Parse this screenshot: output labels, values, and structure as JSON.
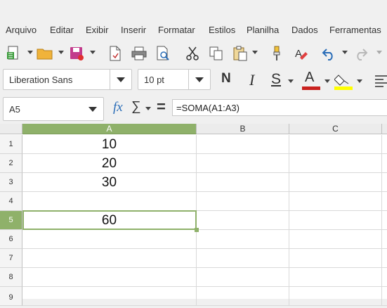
{
  "menu": [
    "Arquivo",
    "Editar",
    "Exibir",
    "Inserir",
    "Formatar",
    "Estilos",
    "Planilha",
    "Dados",
    "Ferramentas"
  ],
  "font": {
    "name": "Liberation Sans",
    "size": "10 pt"
  },
  "format_buttons": {
    "bold": "N",
    "italic": "I",
    "strike": "S",
    "font_color": "A"
  },
  "name_box": "A5",
  "formula": "=SOMA(A1:A3)",
  "functions": {
    "fx": "fx",
    "sum": "∑",
    "equals": "="
  },
  "columns": [
    "A",
    "B",
    "C"
  ],
  "rows": [
    {
      "num": "1",
      "a": "10"
    },
    {
      "num": "2",
      "a": "20"
    },
    {
      "num": "3",
      "a": "30"
    },
    {
      "num": "4",
      "a": ""
    },
    {
      "num": "5",
      "a": "60"
    },
    {
      "num": "6",
      "a": ""
    },
    {
      "num": "7",
      "a": ""
    },
    {
      "num": "8",
      "a": ""
    },
    {
      "num": "9",
      "a": ""
    }
  ],
  "colors": {
    "accent": "#8fb16a",
    "font_color_bar": "#c9211e",
    "highlight_bar": "#ffff00"
  }
}
